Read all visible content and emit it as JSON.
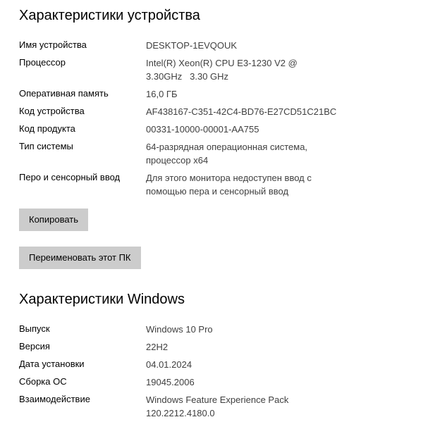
{
  "device_specs": {
    "title": "Характеристики устройства",
    "rows": [
      {
        "label": "Имя устройства",
        "value": [
          "DESKTOP-1EVQOUK"
        ]
      },
      {
        "label": "Процессор",
        "value": [
          "Intel(R) Xeon(R) CPU E3-1230 V2 @",
          "3.30GHz   3.30 GHz"
        ]
      },
      {
        "label": "Оперативная память",
        "value": [
          "16,0 ГБ"
        ]
      },
      {
        "label": "Код устройства",
        "value": [
          "AF438167-C351-42C4-BD76-E27CD51C21BC"
        ]
      },
      {
        "label": "Код продукта",
        "value": [
          "00331-10000-00001-AA755"
        ]
      },
      {
        "label": "Тип системы",
        "value": [
          "64-разрядная операционная система,",
          "процессор x64"
        ]
      },
      {
        "label": "Перо и сенсорный ввод",
        "value": [
          "Для этого монитора недоступен ввод с",
          "помощью пера и сенсорный ввод"
        ]
      }
    ],
    "copy_button": "Копировать",
    "rename_button": "Переименовать этот ПК"
  },
  "windows_specs": {
    "title": "Характеристики Windows",
    "rows": [
      {
        "label": "Выпуск",
        "value": [
          "Windows 10 Pro"
        ]
      },
      {
        "label": "Версия",
        "value": [
          "22H2"
        ]
      },
      {
        "label": "Дата установки",
        "value": [
          "04.01.2024"
        ]
      },
      {
        "label": "Сборка ОС",
        "value": [
          "19045.2006"
        ]
      },
      {
        "label": "Взаимодействие",
        "value": [
          "Windows Feature Experience Pack",
          "120.2212.4180.0"
        ]
      }
    ]
  },
  "colors": {
    "background": "#ffffff",
    "label_text": "#000000",
    "value_text": "#404040",
    "button_bg": "#cccccc"
  }
}
